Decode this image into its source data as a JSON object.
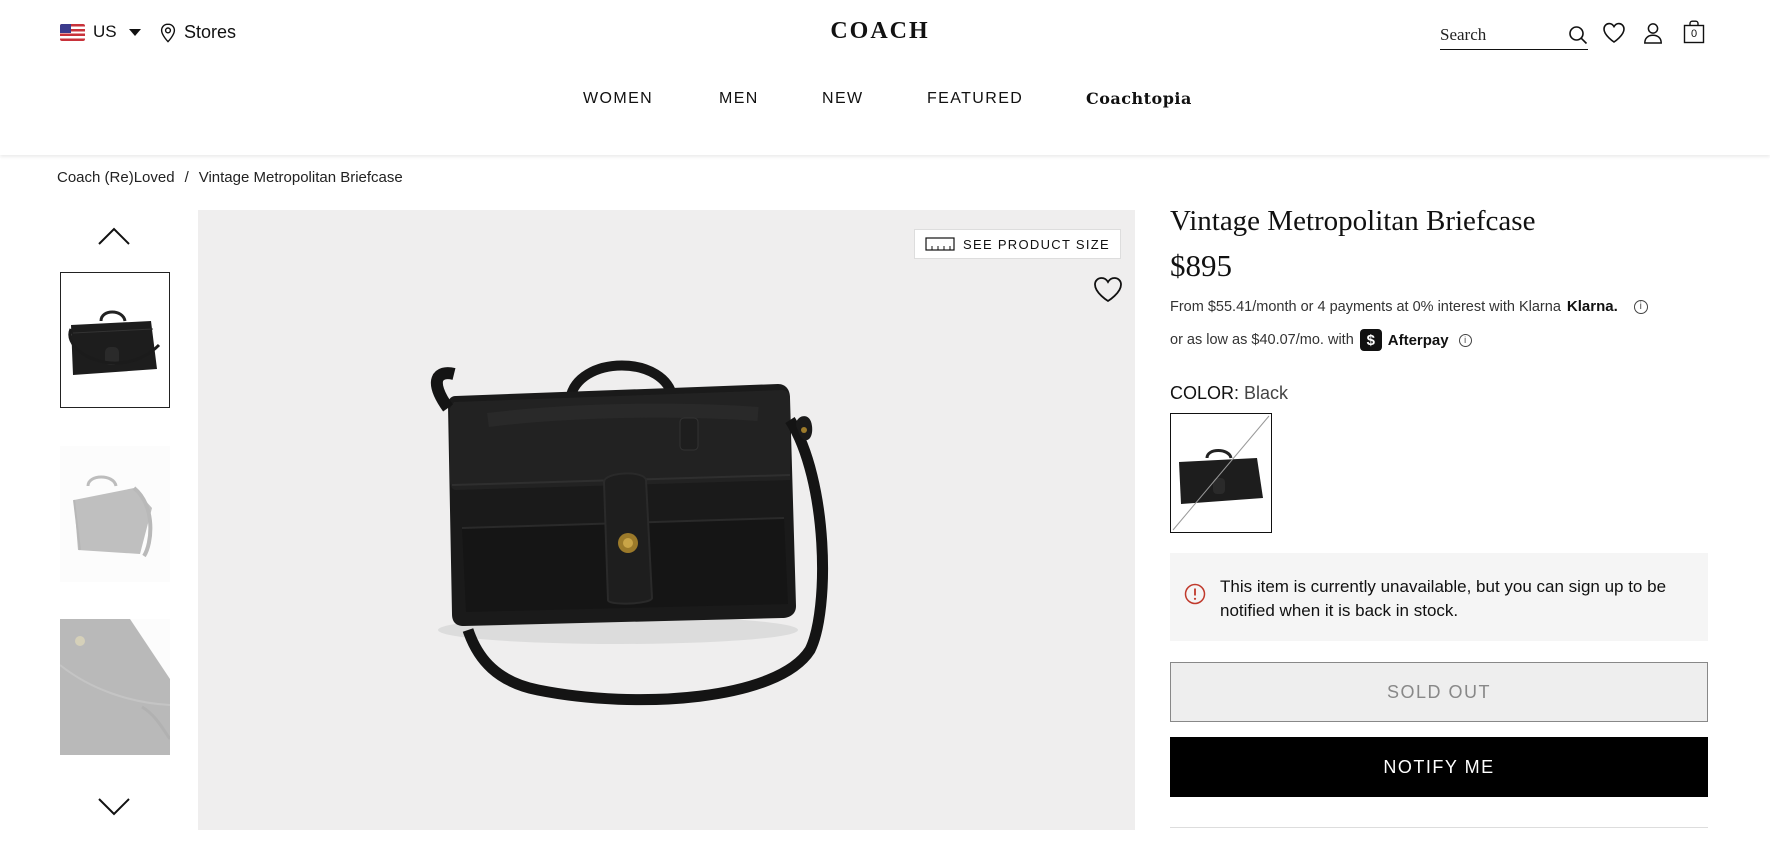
{
  "header": {
    "locale": "US",
    "stores_label": "Stores",
    "logo": "COACH",
    "search_placeholder": "Search",
    "bag_count": "0"
  },
  "nav": {
    "items": [
      "WOMEN",
      "MEN",
      "NEW",
      "FEATURED",
      "Coachtopia"
    ]
  },
  "breadcrumb": {
    "parent": "Coach (Re)Loved",
    "separator": "/",
    "current": "Vintage Metropolitan Briefcase"
  },
  "gallery": {
    "size_button": "SEE PRODUCT SIZE"
  },
  "product": {
    "title": "Vintage Metropolitan Briefcase",
    "price": "$895",
    "klarna_text": "From $55.41/month or 4 payments at 0% interest with Klarna",
    "klarna_brand": "Klarna.",
    "afterpay_text": "or as low as $40.07/mo. with",
    "afterpay_brand": "Afterpay",
    "color_label": "COLOR:",
    "color_value": "Black",
    "notice": "This item is currently unavailable, but you can sign up to be notified when it is back in stock.",
    "soldout_label": "SOLD OUT",
    "notify_label": "NOTIFY ME"
  },
  "colors": {
    "accent": "#000000",
    "alert": "#c0392b",
    "image_bg": "#efeeee"
  }
}
